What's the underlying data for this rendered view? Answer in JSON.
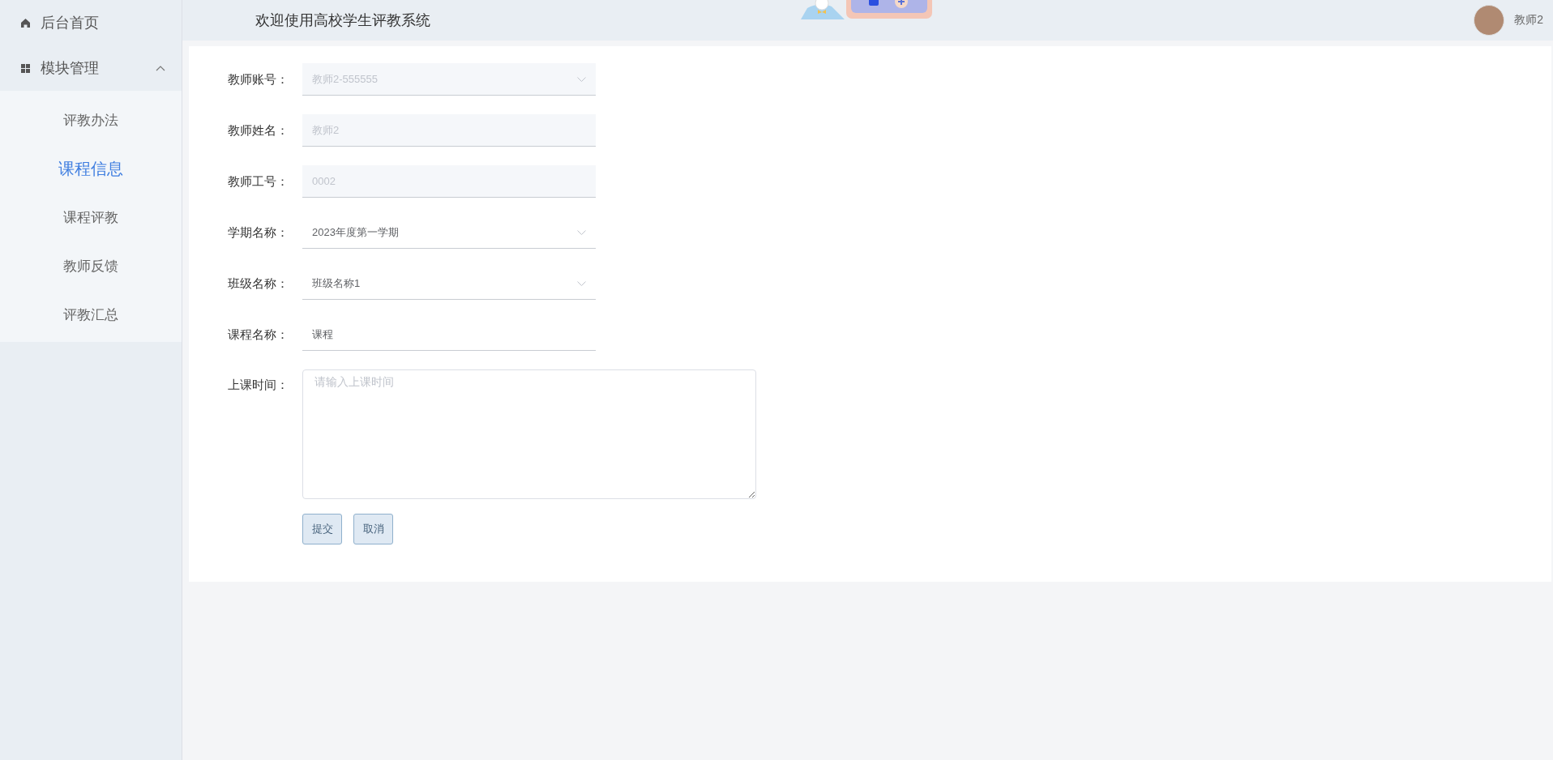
{
  "header": {
    "title": "欢迎使用高校学生评教系统",
    "user": "教师2"
  },
  "sidebar": {
    "items": [
      {
        "label": "后台首页",
        "kind": "home"
      },
      {
        "label": "模块管理",
        "kind": "group",
        "expanded": true,
        "children": [
          {
            "label": "评教办法",
            "selected": false
          },
          {
            "label": "课程信息",
            "selected": true
          },
          {
            "label": "课程评教",
            "selected": false
          },
          {
            "label": "教师反馈",
            "selected": false
          },
          {
            "label": "评教汇总",
            "selected": false
          }
        ]
      }
    ]
  },
  "form": {
    "fields": [
      {
        "label": "教师账号：",
        "kind": "select",
        "value": "教师2-555555",
        "disabled": true
      },
      {
        "label": "教师姓名：",
        "kind": "input",
        "value": "教师2",
        "disabled": true
      },
      {
        "label": "教师工号：",
        "kind": "input",
        "value": "0002",
        "disabled": true
      },
      {
        "label": "学期名称：",
        "kind": "select",
        "value": "2023年度第一学期",
        "disabled": false
      },
      {
        "label": "班级名称：",
        "kind": "select",
        "value": "班级名称1",
        "disabled": false
      },
      {
        "label": "课程名称：",
        "kind": "input",
        "value": "课程",
        "disabled": false
      },
      {
        "label": "上课时间：",
        "kind": "textarea",
        "placeholder": "请输入上课时间"
      }
    ],
    "buttons": [
      "提交",
      "取消"
    ]
  }
}
